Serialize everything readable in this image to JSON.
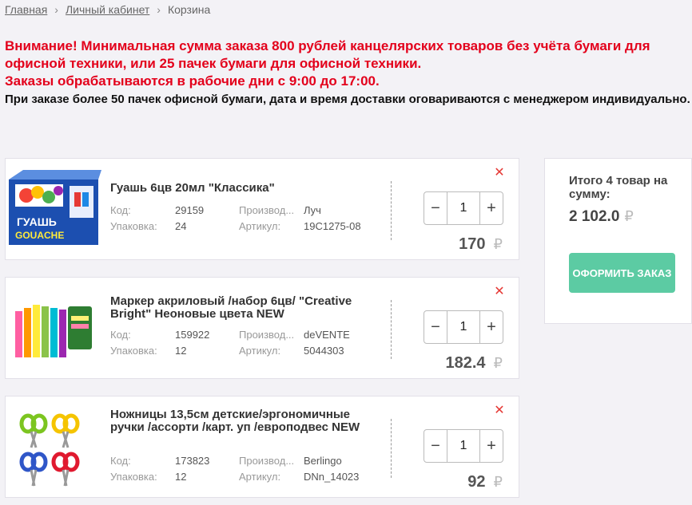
{
  "breadcrumb": {
    "home": "Главная",
    "cabinet": "Личный кабинет",
    "current": "Корзина"
  },
  "notice": {
    "line1": "Внимание! Минимальная сумма заказа 800 рублей канцелярских товаров без учёта бумаги для офисной техники, или 25 пачек бумаги для офисной техники.",
    "line2": "Заказы обрабатываются в рабочие дни с 9:00 до 17:00.",
    "line3": "При заказе более 50 пачек офисной бумаги, дата и время доставки оговариваются с менеджером индивидуально."
  },
  "labels": {
    "code": "Код:",
    "pack": "Упаковка:",
    "maker": "Производ...",
    "article": "Артикул:",
    "currency": "₽"
  },
  "items": [
    {
      "title": "Гуашь 6цв 20мл \"Классика\"",
      "code": "29159",
      "pack": "24",
      "maker": "Луч",
      "article": "19С1275-08",
      "qty": "1",
      "price": "170",
      "image_text_1": "ГУАШЬ",
      "image_text_2": "GOUACHE"
    },
    {
      "title": "Маркер акриловый /набор 6цв/ \"Creative Bright\" Неоновые цвета NEW",
      "code": "159922",
      "pack": "12",
      "maker": "deVENTE",
      "article": "5044303",
      "qty": "1",
      "price": "182.4"
    },
    {
      "title": "Ножницы 13,5см детские/эргономичные ручки /ассорти /карт. уп /европодвес NEW",
      "code": "173823",
      "pack": "12",
      "maker": "Berlingo",
      "article": "DNn_14023",
      "qty": "1",
      "price": "92"
    }
  ],
  "summary": {
    "label": "Итого 4 товар на сумму:",
    "total": "2 102.0",
    "order_button": "Оформить заказ"
  },
  "icons": {
    "remove": "close-icon",
    "minus": "minus-icon",
    "plus": "plus-icon",
    "breadcrumb_sep": "chevron-right-icon"
  },
  "colors": {
    "warning": "#e3001b",
    "accent": "#5ccba3",
    "remove": "#e53935"
  }
}
